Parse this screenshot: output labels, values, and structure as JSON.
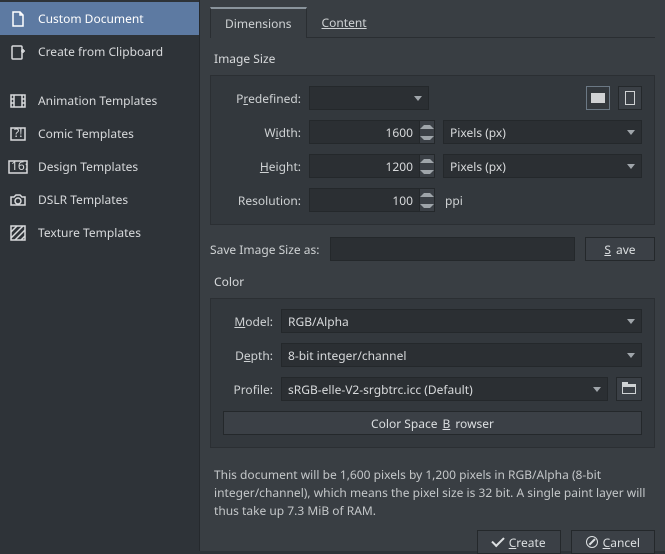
{
  "sidebar": {
    "items": [
      {
        "label": "Custom Document"
      },
      {
        "label": "Create from Clipboard"
      },
      {
        "label": "Animation Templates"
      },
      {
        "label": "Comic Templates"
      },
      {
        "label": "Design Templates"
      },
      {
        "label": "DSLR Templates"
      },
      {
        "label": "Texture Templates"
      }
    ]
  },
  "tabs": {
    "dimensions": "Dimensions",
    "content": "Content"
  },
  "imageSize": {
    "title": "Image Size",
    "predefined_label": "Predefined:",
    "predefined_value": "",
    "width_label": "Width:",
    "width_value": "1600",
    "width_unit": "Pixels (px)",
    "height_label": "Height:",
    "height_value": "1200",
    "height_unit": "Pixels (px)",
    "resolution_label": "Resolution:",
    "resolution_value": "100",
    "resolution_unit": "ppi"
  },
  "save": {
    "label": "Save Image Size as:",
    "value": "",
    "button": "Save"
  },
  "color": {
    "title": "Color",
    "model_label": "Model:",
    "model_value": "RGB/Alpha",
    "depth_label": "Depth:",
    "depth_value": "8-bit integer/channel",
    "profile_label": "Profile:",
    "profile_value": "sRGB-elle-V2-srgbtrc.icc (Default)",
    "browser_button": "Color Space Browser"
  },
  "summary": "This document will be 1,600 pixels by 1,200 pixels in RGB/Alpha (8-bit integer/channel), which means the pixel size is 32 bit. A single paint layer will thus take up 7.3 MiB of RAM.",
  "footer": {
    "create": "Create",
    "cancel": "Cancel"
  }
}
